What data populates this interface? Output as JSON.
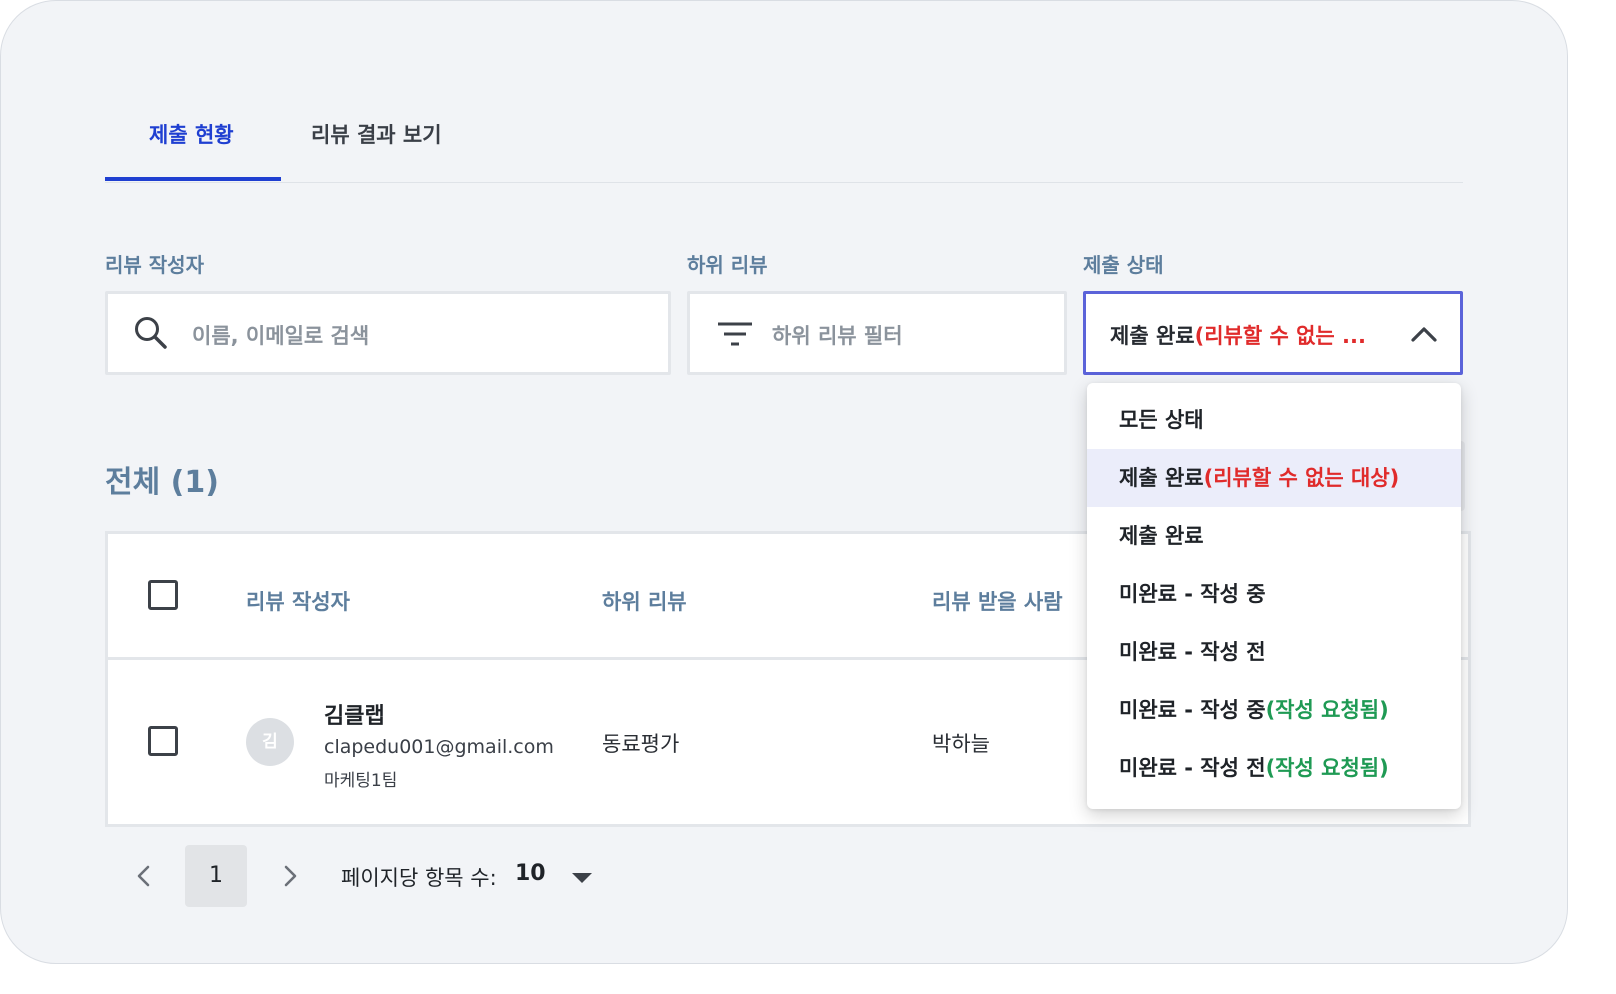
{
  "tabs": [
    {
      "label": "제출 현황",
      "active": true
    },
    {
      "label": "리뷰 결과 보기",
      "active": false
    }
  ],
  "filters": {
    "writer": {
      "label": "리뷰 작성자",
      "placeholder": "이름, 이메일로 검색"
    },
    "subreview": {
      "label": "하위 리뷰",
      "placeholder": "하위 리뷰 필터"
    },
    "status": {
      "label": "제출 상태",
      "selected_main": "제출 완료",
      "selected_note": "(리뷰할 수 없는 ..."
    }
  },
  "total": {
    "label": "전체 (1)"
  },
  "table": {
    "headers": [
      "리뷰 작성자",
      "하위 리뷰",
      "리뷰 받을 사람"
    ],
    "rows": [
      {
        "avatar": "김",
        "name": "김클랩",
        "email": "clapedu001@gmail.com",
        "team": "마케팅1팀",
        "subreview": "동료평가",
        "reviewee": "박하늘"
      }
    ]
  },
  "pagination": {
    "page": "1",
    "per_page_label": "페이지당 항목 수:",
    "per_page_value": "10"
  },
  "status_menu": {
    "items": [
      {
        "main": "모든 상태",
        "note": "",
        "note_color": ""
      },
      {
        "main": "제출 완료",
        "note": "(리뷰할 수 없는 대상)",
        "note_color": "red",
        "highlighted": true
      },
      {
        "main": "제출 완료",
        "note": "",
        "note_color": ""
      },
      {
        "main": "미완료 - 작성 중",
        "note": "",
        "note_color": ""
      },
      {
        "main": "미완료 - 작성 전",
        "note": "",
        "note_color": ""
      },
      {
        "main": "미완료 - 작성 중",
        "note": "(작성 요청됨)",
        "note_color": "green"
      },
      {
        "main": "미완료 - 작성 전",
        "note": "(작성 요청됨)",
        "note_color": "green"
      }
    ]
  },
  "colors": {
    "accent": "#1f3fd1",
    "label": "#5d7e9d",
    "red": "#e02b2b",
    "green": "#1f9a54",
    "select_border": "#5b63d9"
  }
}
